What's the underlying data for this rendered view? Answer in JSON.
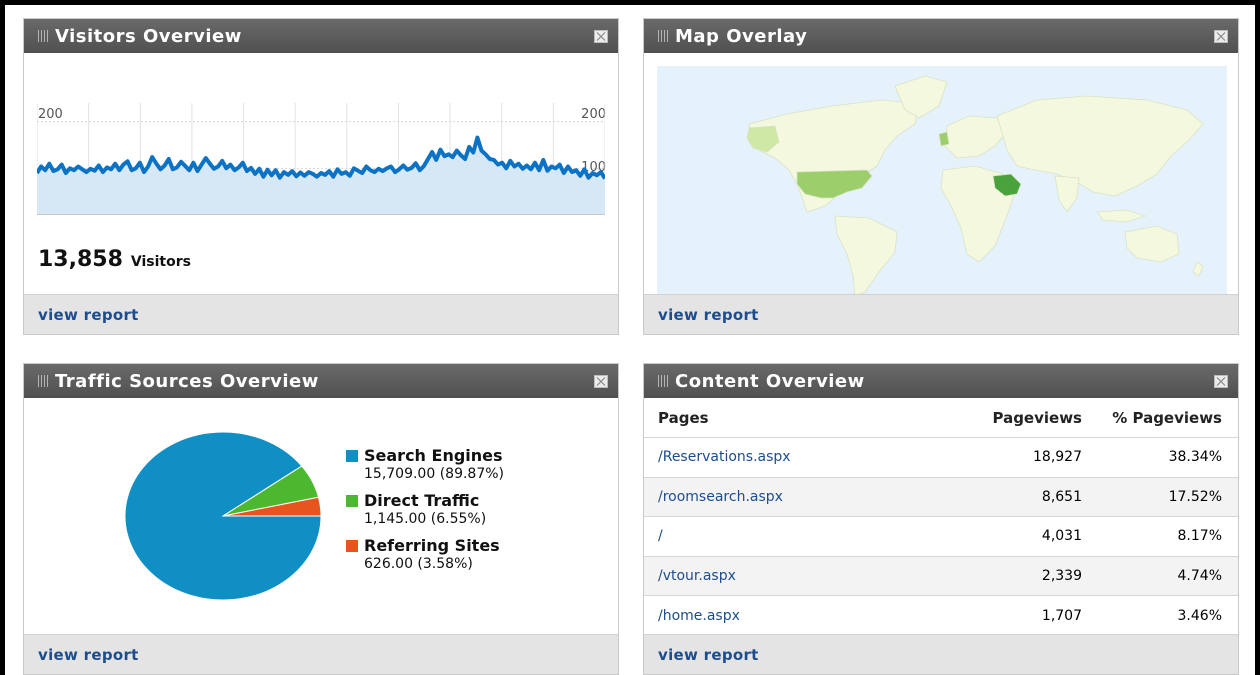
{
  "visitors": {
    "title": "Visitors Overview",
    "axis_top": "200",
    "axis_mid": "100",
    "total": "13,858",
    "total_label": "Visitors",
    "link": "view report",
    "colors": {
      "line": "#0c72c4",
      "fill": "#d6e8f6"
    },
    "chart_data": {
      "type": "area",
      "ylim": [
        0,
        240
      ],
      "values": [
        90,
        104,
        96,
        110,
        94,
        98,
        108,
        90,
        100,
        96,
        104,
        98,
        92,
        99,
        95,
        106,
        92,
        102,
        98,
        110,
        96,
        108,
        115,
        96,
        100,
        112,
        92,
        104,
        124,
        110,
        98,
        106,
        120,
        98,
        102,
        114,
        105,
        96,
        112,
        94,
        108,
        122,
        110,
        99,
        104,
        116,
        100,
        108,
        96,
        102,
        112,
        94,
        101,
        88,
        99,
        82,
        97,
        85,
        96,
        80,
        92,
        86,
        94,
        83,
        91,
        84,
        92,
        88,
        82,
        90,
        86,
        94,
        82,
        98,
        88,
        92,
        84,
        100,
        95,
        90,
        104,
        96,
        92,
        99,
        94,
        100,
        104,
        92,
        98,
        106,
        97,
        101,
        111,
        96,
        105,
        120,
        135,
        118,
        140,
        126,
        130,
        124,
        138,
        128,
        120,
        146,
        134,
        166,
        138,
        130,
        120,
        118,
        108,
        112,
        100,
        116,
        104,
        110,
        99,
        106,
        98,
        112,
        96,
        118,
        95,
        104,
        100,
        108,
        90,
        104,
        92,
        96,
        84,
        98,
        80,
        90,
        85,
        92,
        78
      ]
    }
  },
  "map": {
    "title": "Map Overlay",
    "link": "view report",
    "colors": {
      "ocean": "#e6f2fb",
      "land": "#f4f8de",
      "low": "#cfe8a6",
      "mid": "#9ccf6b",
      "high": "#4aa23c"
    }
  },
  "traffic": {
    "title": "Traffic Sources Overview",
    "link": "view report",
    "legend": [
      {
        "name": "Search Engines",
        "value": "15,709.00 (89.87%)",
        "color": "#0f8fc4"
      },
      {
        "name": "Direct Traffic",
        "value": "1,145.00 (6.55%)",
        "color": "#4cb82f"
      },
      {
        "name": "Referring Sites",
        "value": "626.00 (3.58%)",
        "color": "#e8541e"
      }
    ],
    "chart_data": {
      "type": "pie",
      "categories": [
        "Search Engines",
        "Direct Traffic",
        "Referring Sites"
      ],
      "values": [
        15709,
        1145,
        626
      ]
    }
  },
  "content": {
    "title": "Content Overview",
    "headers": {
      "page": "Pages",
      "pv": "Pageviews",
      "pct": "% Pageviews"
    },
    "rows": [
      {
        "page": "/Reservations.aspx",
        "pv": "18,927",
        "pct": "38.34%"
      },
      {
        "page": "/roomsearch.aspx",
        "pv": "8,651",
        "pct": "17.52%"
      },
      {
        "page": "/",
        "pv": "4,031",
        "pct": "8.17%"
      },
      {
        "page": "/vtour.aspx",
        "pv": "2,339",
        "pct": "4.74%"
      },
      {
        "page": "/home.aspx",
        "pv": "1,707",
        "pct": "3.46%"
      }
    ],
    "link": "view report"
  }
}
